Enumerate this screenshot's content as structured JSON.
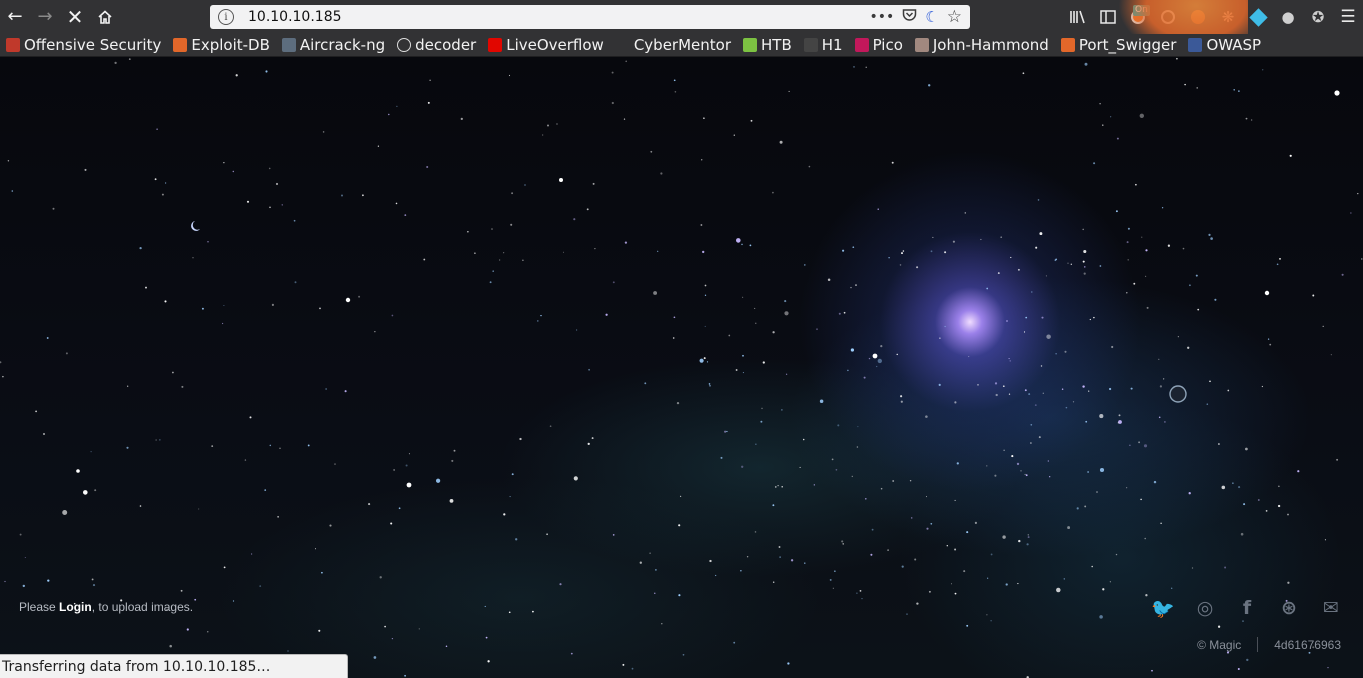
{
  "browser": {
    "url": "10.10.10.185",
    "addon_badge": "On",
    "bookmarks": [
      {
        "label": "Offensive Security",
        "icon": "offsec-icon",
        "color": "#c0392b"
      },
      {
        "label": "Exploit-DB",
        "icon": "exploitdb-icon",
        "color": "#e2672a"
      },
      {
        "label": "Aircrack-ng",
        "icon": "aircrack-icon",
        "color": "#5d6d7e"
      },
      {
        "label": "decoder",
        "icon": "globe-icon",
        "color": "#dddddd"
      },
      {
        "label": "LiveOverflow",
        "icon": "liveoverflow-icon",
        "color": "#e10600"
      },
      {
        "label": "CyberMentor",
        "icon": "none",
        "color": "#323234"
      },
      {
        "label": "HTB",
        "icon": "htb-icon",
        "color": "#7cc242"
      },
      {
        "label": "H1",
        "icon": "hackerone-icon",
        "color": "#444444"
      },
      {
        "label": "Pico",
        "icon": "pico-icon",
        "color": "#c2185b"
      },
      {
        "label": "John-Hammond",
        "icon": "john-hammond-icon",
        "color": "#a1887f"
      },
      {
        "label": "Port_Swigger",
        "icon": "portswigger-icon",
        "color": "#e2672a"
      },
      {
        "label": "OWASP",
        "icon": "owasp-icon",
        "color": "#3b5998"
      }
    ]
  },
  "page": {
    "login_prefix": "Please ",
    "login_link": "Login",
    "login_suffix": ", to upload images.",
    "socials": [
      {
        "icon": "twitter-icon",
        "glyph": "🐦"
      },
      {
        "icon": "instagram-icon",
        "glyph": "◎"
      },
      {
        "icon": "facebook-icon",
        "glyph": "f"
      },
      {
        "icon": "dribbble-icon",
        "glyph": "⊛"
      },
      {
        "icon": "mail-icon",
        "glyph": "✉"
      }
    ],
    "copyright": "© Magic",
    "hash": "4d61676963"
  },
  "status": {
    "text": "Transferring data from 10.10.10.185…"
  }
}
